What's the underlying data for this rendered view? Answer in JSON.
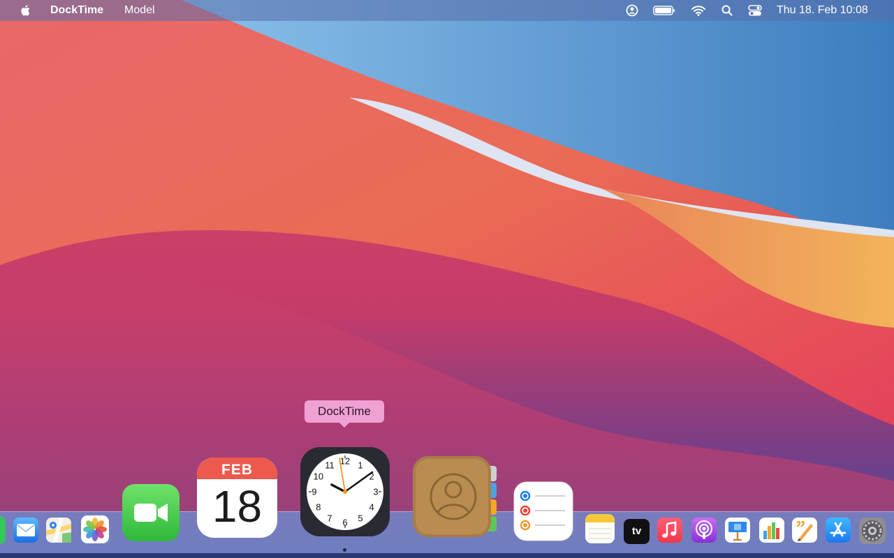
{
  "menubar": {
    "apple_icon": "apple-logo-icon",
    "app_name": "DockTime",
    "menus": [
      "Model"
    ],
    "status_icons": [
      "user-account-icon",
      "battery-icon",
      "wifi-icon",
      "spotlight-search-icon",
      "control-center-icon"
    ],
    "clock": "Thu 18. Feb  10:08"
  },
  "dock": {
    "tooltip": "DockTime",
    "calendar": {
      "month": "FEB",
      "day": "18"
    },
    "tv_label": "tv",
    "apps": [
      "messages-icon",
      "mail-icon",
      "maps-icon",
      "photos-icon",
      "facetime-icon",
      "calendar-icon",
      "docktime-clock-icon",
      "contacts-icon",
      "reminders-icon",
      "notes-icon",
      "apple-tv-icon",
      "music-icon",
      "podcasts-icon",
      "keynote-icon",
      "numbers-icon",
      "pages-icon",
      "app-store-icon",
      "system-preferences-icon"
    ]
  },
  "clock_face": {
    "numbers": [
      "12",
      "1",
      "2",
      "3",
      "4",
      "5",
      "6",
      "7",
      "8",
      "9",
      "10",
      "11"
    ]
  },
  "colors": {
    "tooltip_bg": "#f0a1d3",
    "menubar_text": "#ffffff",
    "calendar_red": "#ec5a4d"
  }
}
